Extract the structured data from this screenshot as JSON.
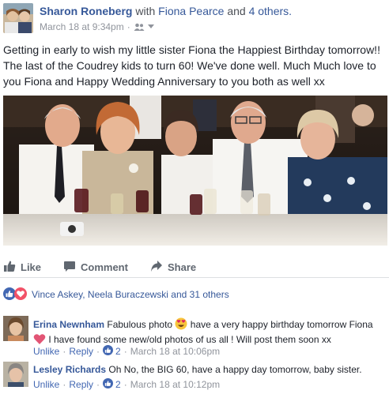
{
  "post": {
    "author": "Sharon Roneberg",
    "with_text": "with",
    "tagged_person": "Fiona Pearce",
    "and_text": "and",
    "others_text": "4 others.",
    "timestamp": "March 18 at 9:34pm",
    "separator": "·",
    "privacy_icon": "friends-icon",
    "text": "Getting in early to wish my little sister Fiona the Happiest Birthday tomorrow!! The last of the Coudrey kids to turn 60! We've done well. Much Much love to you Fiona and Happy Wedding Anniversary to you both as well xx"
  },
  "actions": {
    "like": "Like",
    "comment": "Comment",
    "share": "Share"
  },
  "reactions": {
    "summary": "Vince Askey, Neela Buraczewski and 31 others"
  },
  "comments": [
    {
      "author": "Erina Newnham",
      "text_part1": "Fabulous photo",
      "text_part2": "have a very happy birthday tomorrow Fiona",
      "text_part3": "I have found some new/old photos of us all ! Will post them soon xx",
      "unlike": "Unlike",
      "reply": "Reply",
      "sep": "·",
      "like_count": "2",
      "time": "March 18 at 10:06pm"
    },
    {
      "author": "Lesley Richards",
      "text": "Oh No, the BIG 60, have a happy day tomorrow, baby sister.",
      "unlike": "Unlike",
      "reply": "Reply",
      "sep": "·",
      "like_count": "2",
      "time": "March 18 at 10:12pm"
    }
  ],
  "colors": {
    "link": "#365899",
    "muted": "#90949c",
    "like_blue": "#4267b2",
    "love_red": "#f25268"
  }
}
